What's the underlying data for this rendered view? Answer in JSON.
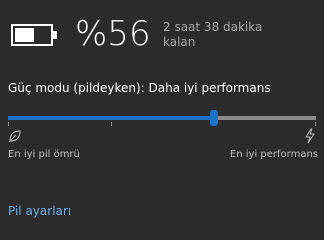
{
  "battery": {
    "percent_text": "%56",
    "level": 0.56,
    "remaining_text": "2 saat 38 dakika kalan"
  },
  "power_mode": {
    "label": "Güç modu (pildeyken): Daha iyi performans",
    "slider_position": 0.67,
    "left_label": "En iyi pil ömrü",
    "right_label": "En iyi performans",
    "left_icon": "leaf-icon",
    "right_icon": "lightning-bolt-icon"
  },
  "footer": {
    "settings_link": "Pil ayarları"
  },
  "colors": {
    "background": "#2b2b2b",
    "accent": "#1a73c8",
    "link": "#6aaef0"
  }
}
